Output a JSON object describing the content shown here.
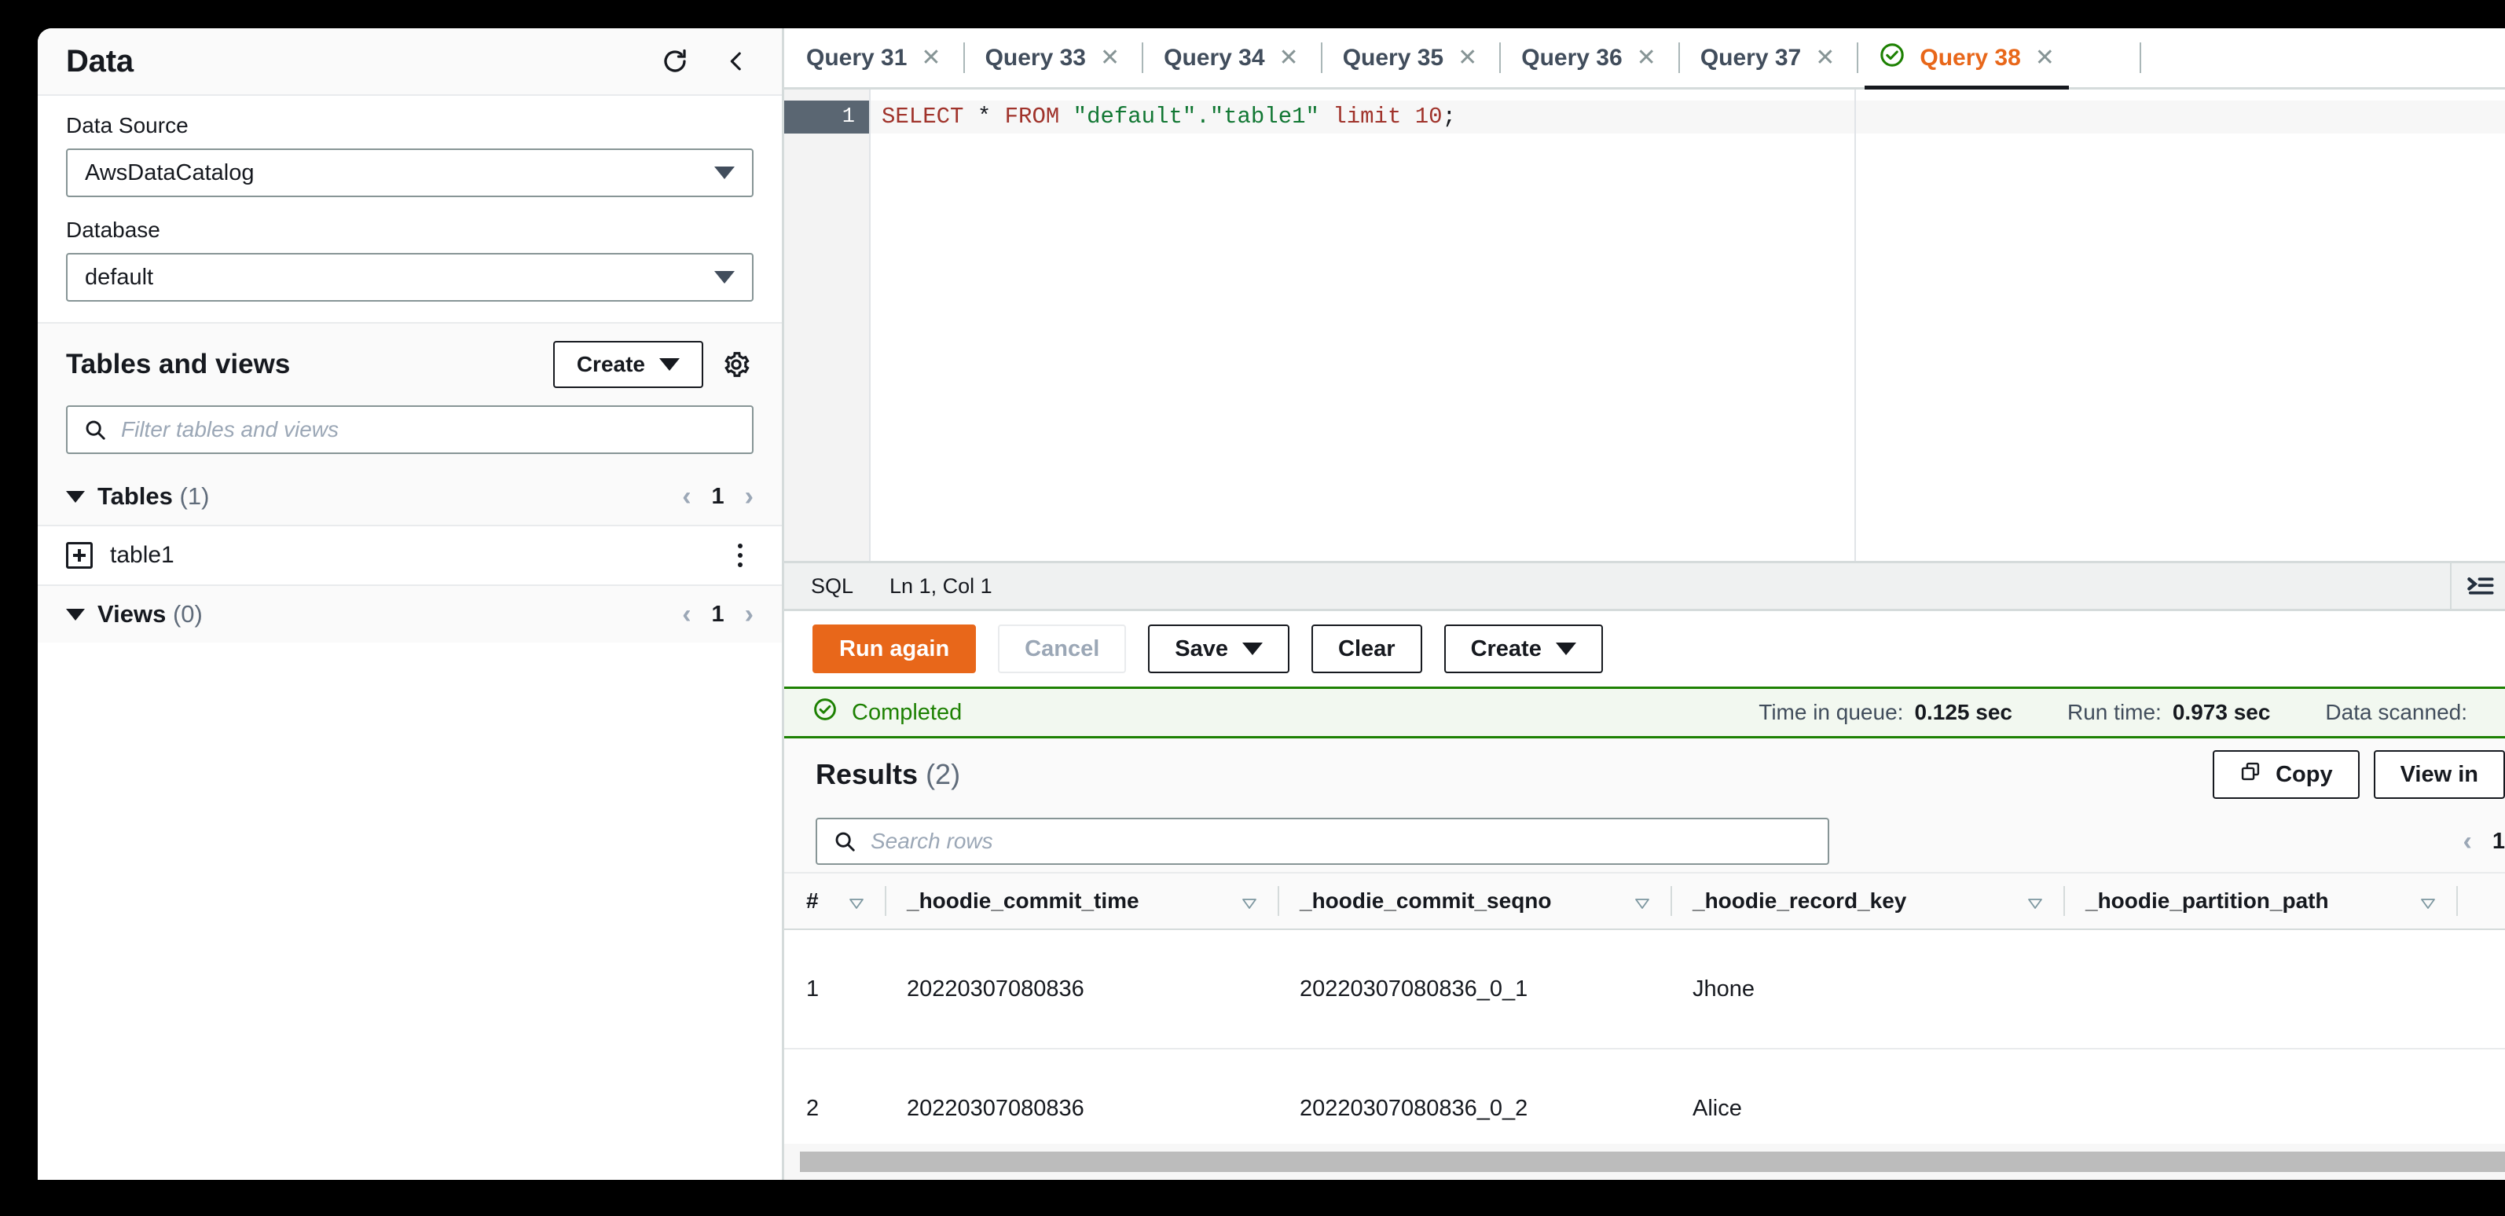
{
  "sidebar": {
    "title": "Data",
    "refresh_icon": "refresh-icon",
    "collapse_icon": "chevron-left-icon",
    "data_source": {
      "label": "Data Source",
      "value": "AwsDataCatalog"
    },
    "database": {
      "label": "Database",
      "value": "default"
    },
    "tables_and_views": {
      "title": "Tables and views",
      "create_label": "Create",
      "settings_icon": "gear-icon",
      "filter_placeholder": "Filter tables and views",
      "filter_value": "",
      "tables_group": {
        "label": "Tables",
        "count": "(1)",
        "page": "1"
      },
      "views_group": {
        "label": "Views",
        "count": "(0)",
        "page": "1"
      },
      "tables": [
        {
          "name": "table1",
          "icon": "table-add-icon"
        }
      ]
    }
  },
  "tabs": [
    {
      "label": "Query 31",
      "active": false
    },
    {
      "label": "Query 33",
      "active": false
    },
    {
      "label": "Query 34",
      "active": false
    },
    {
      "label": "Query 35",
      "active": false
    },
    {
      "label": "Query 36",
      "active": false
    },
    {
      "label": "Query 37",
      "active": false
    },
    {
      "label": "Query 38",
      "active": true,
      "status_icon": "check-circle-icon"
    }
  ],
  "editor": {
    "line_number": "1",
    "sql_tokens": {
      "select": "SELECT",
      "star": " * ",
      "from": "FROM",
      "db": " \"default\".\"table1\" ",
      "limit": "limit",
      "ten": " 10",
      "semi": ";"
    },
    "full_sql": "SELECT * FROM \"default\".\"table1\" limit 10;"
  },
  "status_strip": {
    "language": "SQL",
    "cursor": "Ln 1, Col 1",
    "format_icon": "format-indent-icon"
  },
  "actions": {
    "run_again": "Run again",
    "cancel": "Cancel",
    "save": "Save",
    "clear": "Clear",
    "create": "Create"
  },
  "banner": {
    "status_icon": "check-circle-icon",
    "status": "Completed",
    "time_in_queue_label": "Time in queue:",
    "time_in_queue_value": "0.125 sec",
    "run_time_label": "Run time:",
    "run_time_value": "0.973 sec",
    "data_scanned_label": "Data scanned:"
  },
  "results": {
    "title": "Results",
    "count": "(2)",
    "copy_label": "Copy",
    "copy_icon": "copy-icon",
    "view_in_label": "View in",
    "search_placeholder": "Search rows",
    "search_value": "",
    "page": "1",
    "prev_icon": "chevron-left-icon",
    "columns": [
      "#",
      "_hoodie_commit_time",
      "_hoodie_commit_seqno",
      "_hoodie_record_key",
      "_hoodie_partition_path"
    ],
    "rows": [
      {
        "index": "1",
        "_hoodie_commit_time": "20220307080836",
        "_hoodie_commit_seqno": "20220307080836_0_1",
        "_hoodie_record_key": "Jhone",
        "_hoodie_partition_path": ""
      },
      {
        "index": "2",
        "_hoodie_commit_time": "20220307080836",
        "_hoodie_commit_seqno": "20220307080836_0_2",
        "_hoodie_record_key": "Alice",
        "_hoodie_partition_path": ""
      }
    ]
  },
  "colors": {
    "accent_orange": "#e8671a",
    "success_green": "#1d8102",
    "text_dark": "#16191f",
    "border_grey": "#d5dbdb"
  }
}
